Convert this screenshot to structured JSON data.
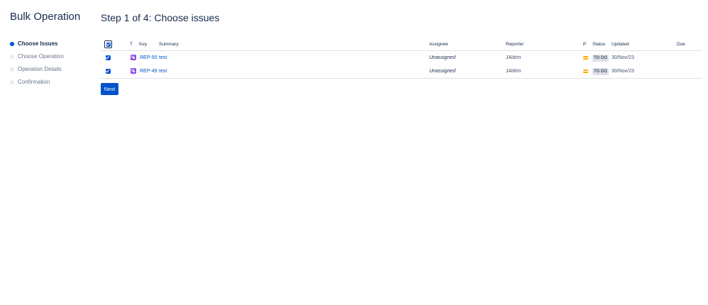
{
  "sidebar": {
    "title": "Bulk Operation",
    "steps": [
      {
        "label": "Choose Issues",
        "active": true
      },
      {
        "label": "Choose Operation",
        "active": false
      },
      {
        "label": "Operation Details",
        "active": false
      },
      {
        "label": "Confirmation",
        "active": false
      }
    ]
  },
  "main": {
    "title": "Step 1 of 4: Choose issues",
    "table": {
      "headers": {
        "type": "T",
        "key": "Key",
        "summary": "Summary",
        "assignee": "Assignee",
        "reporter": "Reporter",
        "priority": "P",
        "status": "Status",
        "updated": "Updated",
        "due": "Due"
      },
      "select_all_checked": true,
      "rows": [
        {
          "checked": true,
          "type_icon": "subtask-icon",
          "key": "REP-50",
          "summary": "test",
          "assignee": "Unassigned",
          "reporter": "JAldrin",
          "priority_icon": "priority-medium-icon",
          "status": "TO DO",
          "updated": "30/Nov/23",
          "due": ""
        },
        {
          "checked": true,
          "type_icon": "subtask-icon",
          "key": "REP-49",
          "summary": "test",
          "assignee": "Unassigned",
          "reporter": "JAldrin",
          "priority_icon": "priority-medium-icon",
          "status": "TO DO",
          "updated": "30/Nov/23",
          "due": ""
        }
      ]
    },
    "next_label": "Next"
  },
  "colors": {
    "accent": "#0052cc",
    "subtask_icon": "#904ee2",
    "priority_medium": "#ffab00",
    "status_todo_bg": "#dfe1e6"
  }
}
